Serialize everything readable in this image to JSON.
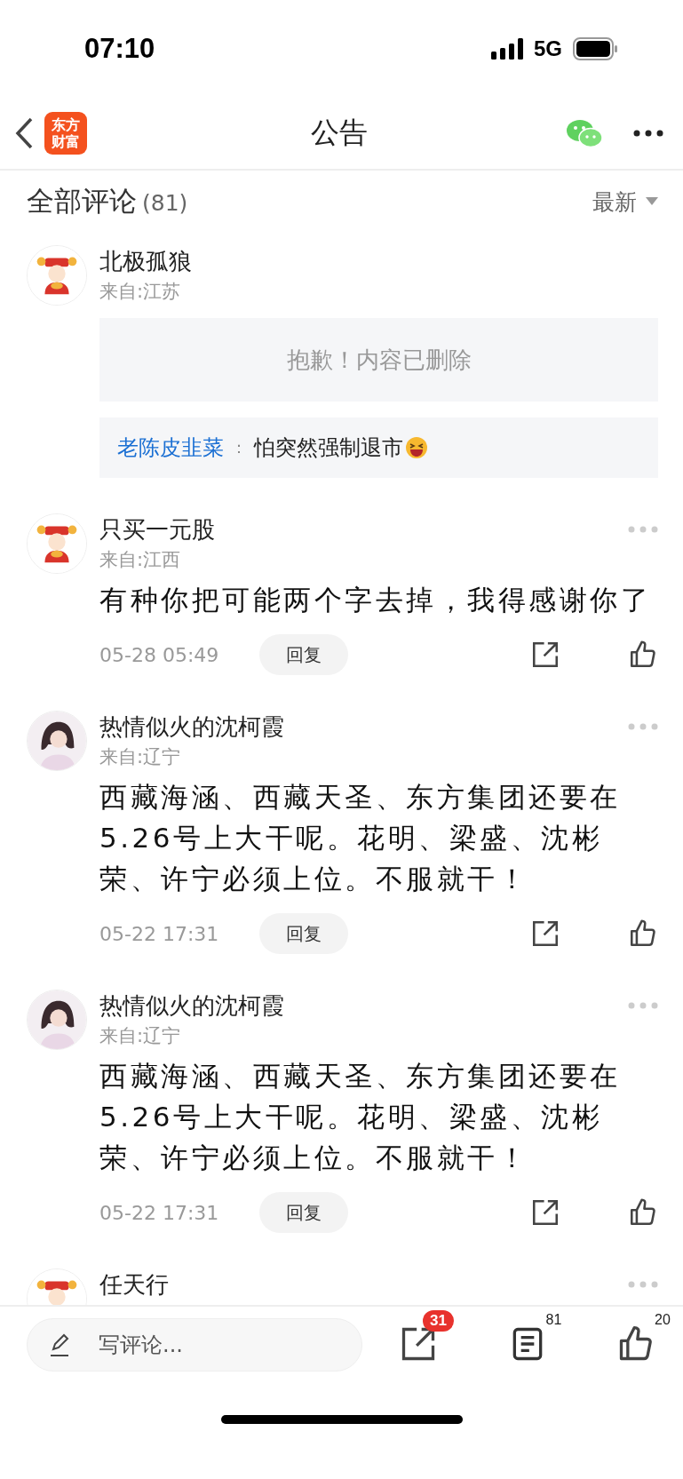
{
  "status_bar": {
    "time": "07:10",
    "network": "5G"
  },
  "nav": {
    "logo_lines": [
      "东方",
      "财富"
    ],
    "title": "公告"
  },
  "comments_header": {
    "title": "全部评论",
    "count": "(81)",
    "sort": "最新"
  },
  "comments": [
    {
      "kind": "deleted",
      "name": "北极孤狼",
      "source": "来自:江苏",
      "notice": "抱歉！内容已删除",
      "reply": {
        "author": "老陈皮韭菜",
        "separator": "：",
        "text": "怕突然强制退市"
      }
    },
    {
      "kind": "post",
      "name": "只买一元股",
      "source": "来自:江西",
      "text": "有种你把可能两个字去掉，我得感谢你了",
      "date": "05-28 05:49",
      "reply_label": "回复"
    },
    {
      "kind": "post",
      "name": "热情似火的沈柯霞",
      "source": "来自:辽宁",
      "text": "西藏海涵、西藏天圣、东方集团还要在5.26号上大干呢。花明、梁盛、沈彬荣、许宁必须上位。不服就干！",
      "date": "05-22 17:31",
      "reply_label": "回复"
    },
    {
      "kind": "post",
      "name": "热情似火的沈柯霞",
      "source": "来自:辽宁",
      "text": "西藏海涵、西藏天圣、东方集团还要在5.26号上大干呢。花明、梁盛、沈彬荣、许宁必须上位。不服就干！",
      "date": "05-22 17:31",
      "reply_label": "回复"
    },
    {
      "kind": "partial",
      "name": "任天行"
    }
  ],
  "footer": {
    "placeholder": "写评论...",
    "share_badge": "31",
    "comments_count": "81",
    "likes_count": "20"
  }
}
